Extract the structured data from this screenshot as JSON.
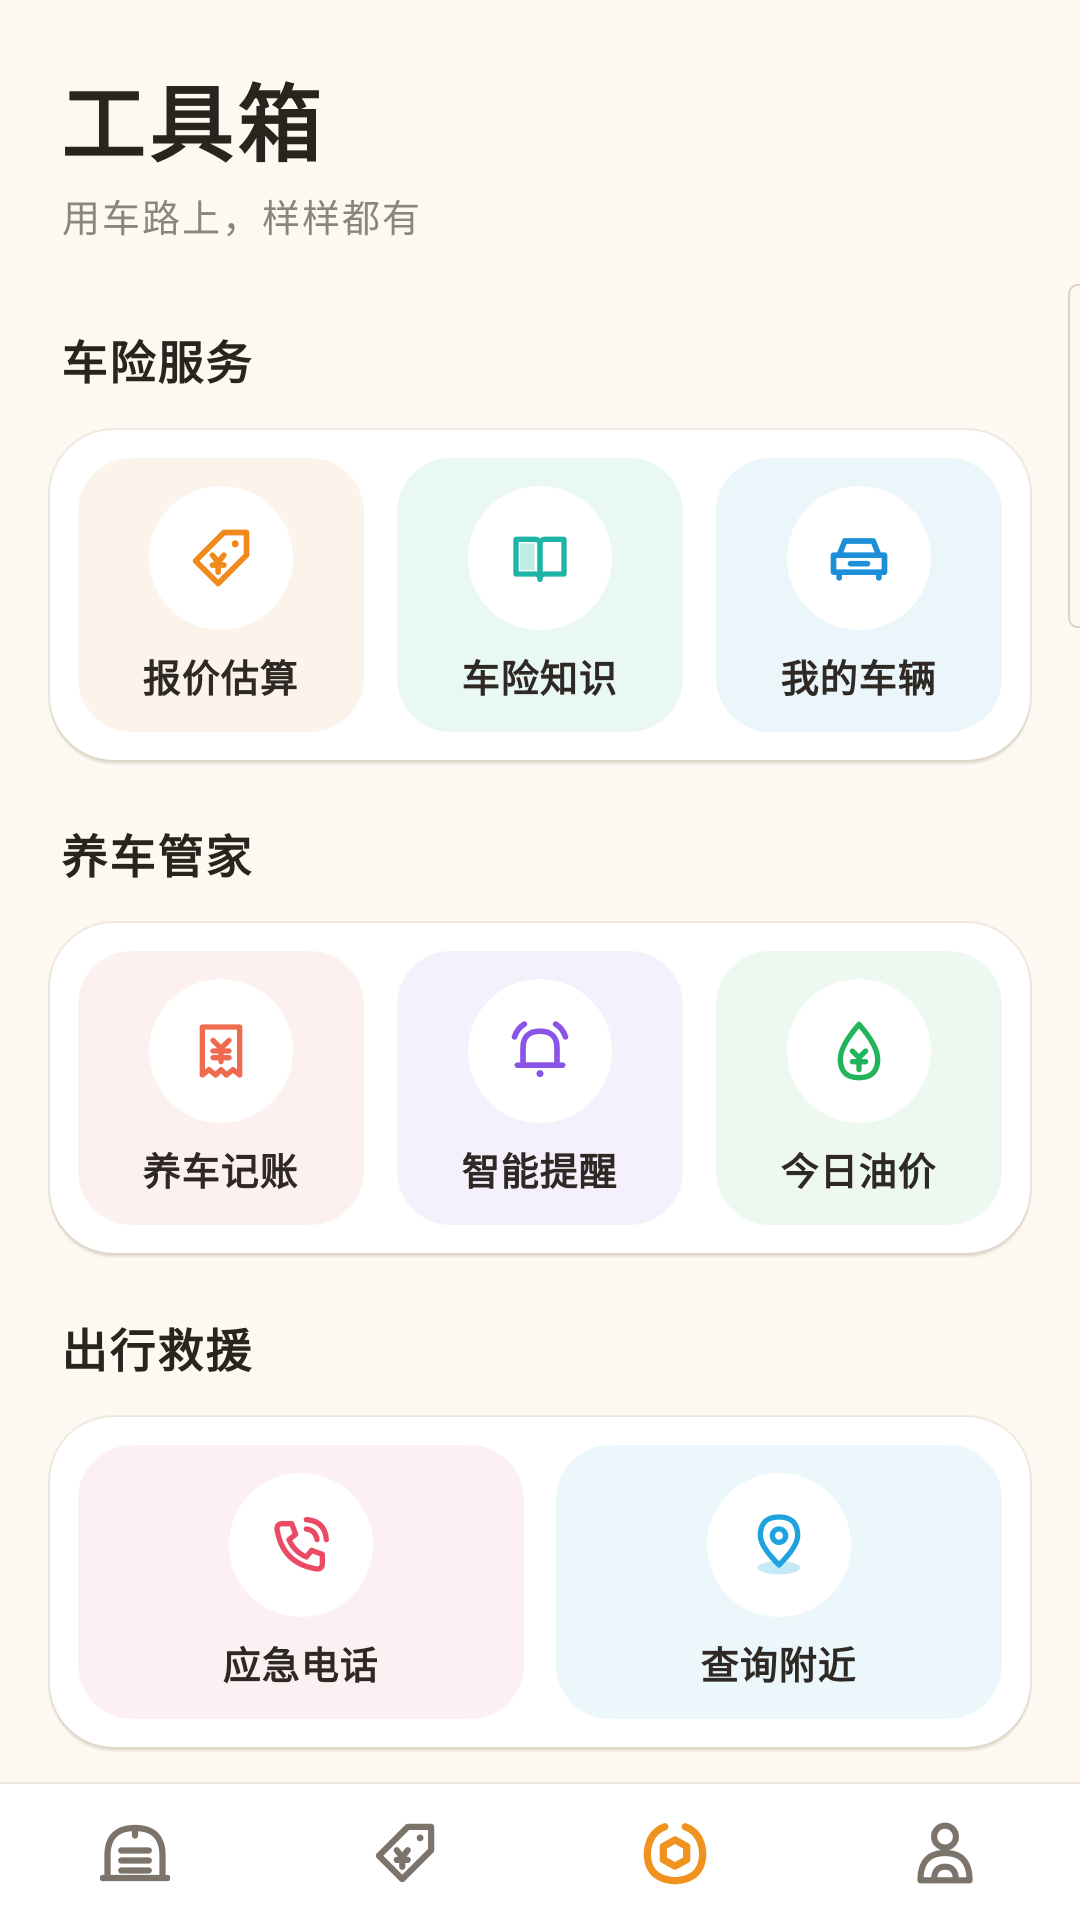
{
  "header": {
    "title": "工具箱",
    "subtitle": "用车路上，样样都有"
  },
  "sections": [
    {
      "title": "车险服务",
      "items": [
        {
          "label": "报价估算",
          "icon": "price-tag-yuan-icon",
          "color": "#f08a1c",
          "bg": "#fcf4ea"
        },
        {
          "label": "车险知识",
          "icon": "book-icon",
          "color": "#1fb5a6",
          "bg": "#eaf8f5"
        },
        {
          "label": "我的车辆",
          "icon": "car-icon",
          "color": "#1c8fd8",
          "bg": "#ebf6fb"
        }
      ]
    },
    {
      "title": "养车管家",
      "items": [
        {
          "label": "养车记账",
          "icon": "receipt-icon",
          "color": "#f06a4f",
          "bg": "#fdf1ef"
        },
        {
          "label": "智能提醒",
          "icon": "bell-icon",
          "color": "#8a55e6",
          "bg": "#f4f0fc"
        },
        {
          "label": "今日油价",
          "icon": "oil-drop-yuan-icon",
          "color": "#22b45a",
          "bg": "#edf8f0"
        }
      ]
    },
    {
      "title": "出行救援",
      "items": [
        {
          "label": "应急电话",
          "icon": "phone-call-icon",
          "color": "#ea4a63",
          "bg": "#fdf0f2"
        },
        {
          "label": "查询附近",
          "icon": "location-pin-icon",
          "color": "#1fa2e0",
          "bg": "#ebf7fb"
        }
      ]
    }
  ],
  "bottom_nav": [
    {
      "icon": "garage-icon",
      "active": false
    },
    {
      "icon": "price-tag-icon",
      "active": false
    },
    {
      "icon": "toolbox-icon",
      "active": true
    },
    {
      "icon": "user-profile-icon",
      "active": false
    }
  ],
  "colors": {
    "nav_inactive": "#7c736a",
    "nav_active": "#f0921e",
    "background": "#fdf9f2"
  }
}
